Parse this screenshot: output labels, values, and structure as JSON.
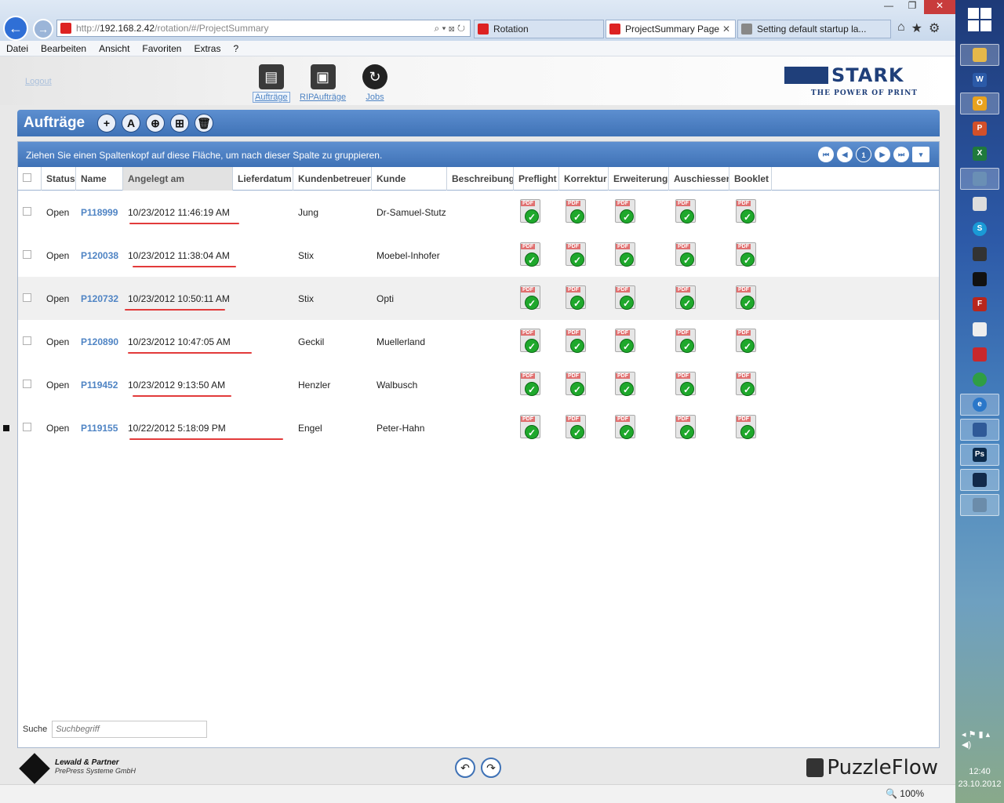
{
  "browser": {
    "url_prefix": "http://",
    "url_host": "192.168.2.42",
    "url_path": "/rotation/#/ProjectSummary",
    "tools": "⌕ ▾ ⊠ ↻",
    "tabs": [
      {
        "label": "Rotation"
      },
      {
        "label": "ProjectSummary Page",
        "close": "✕"
      },
      {
        "label": "Setting default startup la..."
      }
    ],
    "menu": [
      "Datei",
      "Bearbeiten",
      "Ansicht",
      "Favoriten",
      "Extras",
      "?"
    ],
    "window_controls": [
      "—",
      "❐",
      "✕"
    ]
  },
  "app": {
    "logout": "Logout",
    "nav": [
      {
        "label": "Aufträge"
      },
      {
        "label": "RIPAufträge"
      },
      {
        "label": "Jobs"
      }
    ],
    "brand": {
      "word": "STARK",
      "tagline": "THE POWER OF PRINT"
    },
    "panel_title": "Aufträge",
    "toolbar_glyphs": [
      "+",
      "A",
      "⊕",
      "⊞",
      "🗑"
    ],
    "group_hint": "Ziehen Sie einen Spaltenkopf auf diese Fläche, um nach dieser Spalte zu gruppieren.",
    "pager": {
      "first": "⏮",
      "prev": "◀",
      "page": "1",
      "next": "▶",
      "last": "⏭",
      "menu": "▾"
    },
    "columns": [
      "Status",
      "Name",
      "Angelegt am",
      "Lieferdatum",
      "Kundenbetreuer",
      "Kunde",
      "Beschreibung",
      "Preflight",
      "Korrektur",
      "Erweiterung",
      "Auschiessen",
      "Booklet"
    ],
    "pdf_label": "PDF",
    "check_glyph": "✓",
    "rows": [
      {
        "status": "Open",
        "name": "P118999",
        "created": "10/23/2012 11:46:19 AM",
        "delivery": "",
        "account": "Jung",
        "customer": "Dr-Samuel-Stutz",
        "description": ""
      },
      {
        "status": "Open",
        "name": "P120038",
        "created": "10/23/2012 11:38:04 AM",
        "delivery": "",
        "account": "Stix",
        "customer": "Moebel-Inhofer",
        "description": ""
      },
      {
        "status": "Open",
        "name": "P120732",
        "created": "10/23/2012 10:50:11 AM",
        "delivery": "",
        "account": "Stix",
        "customer": "Opti",
        "description": ""
      },
      {
        "status": "Open",
        "name": "P120890",
        "created": "10/23/2012 10:47:05 AM",
        "delivery": "",
        "account": "Geckil",
        "customer": "Muellerland",
        "description": ""
      },
      {
        "status": "Open",
        "name": "P119452",
        "created": "10/23/2012 9:13:50 AM",
        "delivery": "",
        "account": "Henzler",
        "customer": "Walbusch",
        "description": ""
      },
      {
        "status": "Open",
        "name": "P119155",
        "created": "10/22/2012 5:18:09 PM",
        "delivery": "",
        "account": "Engel",
        "customer": "Peter-Hahn",
        "description": ""
      }
    ],
    "search": {
      "label": "Suche",
      "placeholder": "Suchbegriff"
    },
    "footer": {
      "lp_name": "Lewald & Partner",
      "lp_sub": "PrePress Systeme GmbH",
      "undo": "↶",
      "redo": "↷",
      "puzzle": "PuzzleFlow"
    },
    "zoom": "🔍 100%"
  },
  "system": {
    "time": "12:40",
    "date": "23.10.2012",
    "tray": "◂ ⚑ ▮ ▴ ◀)"
  },
  "colors": {
    "accent": "#4f84c4",
    "header_blue": "#3f72b6",
    "check_green": "#1fa82c",
    "annotation_red": "#e23b3b"
  }
}
